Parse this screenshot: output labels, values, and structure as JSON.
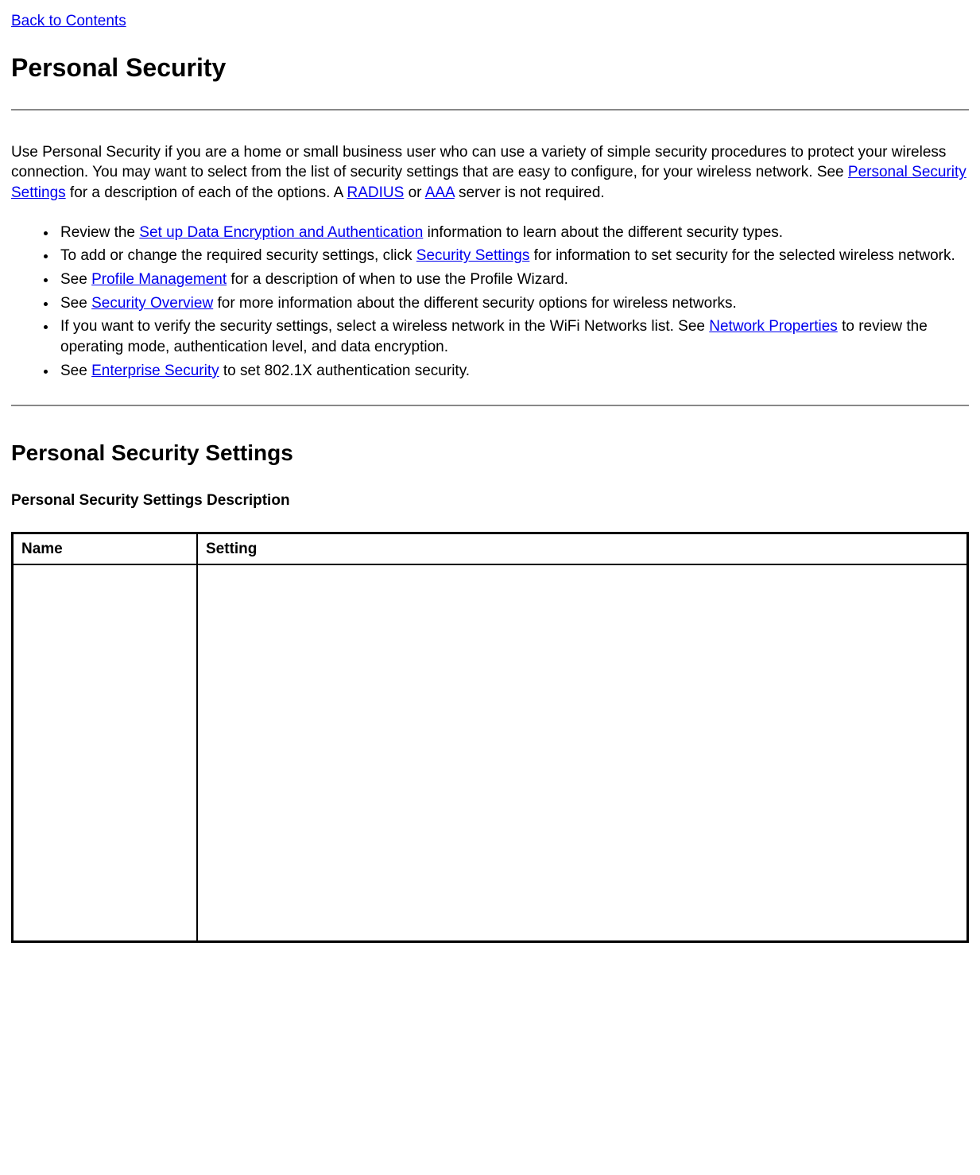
{
  "top_link": "Back to Contents",
  "h1": "Personal Security",
  "intro": {
    "t1": "Use Personal Security if you are a home or small business user who can use a variety of simple security procedures to protect your wireless connection. You may want to select from the list of security settings that are easy to configure, for your wireless network. See ",
    "link_personal_security_settings": "Personal Security Settings",
    "t2": " for a description of each of the options. A ",
    "link_radius": "RADIUS",
    "t3": " or ",
    "link_aaa": "AAA",
    "t4": " server is not required."
  },
  "bullets": {
    "b1_a": "Review the ",
    "b1_link": "Set up Data Encryption and Authentication",
    "b1_b": " information to learn about the different security types.",
    "b2_a": "To add or change the required security settings, click ",
    "b2_link": "Security Settings",
    "b2_b": " for information to set security for the selected wireless network.",
    "b3_a": "See ",
    "b3_link": "Profile Management",
    "b3_b": " for a description of when to use the Profile Wizard.",
    "b4_a": "See ",
    "b4_link": "Security Overview",
    "b4_b": " for more information about the different security options for wireless networks.",
    "b5_a": "If you want to verify the security settings, select a wireless network in the WiFi Networks list. See ",
    "b5_link": "Network Properties",
    "b5_b": " to review the operating mode, authentication level, and data encryption.",
    "b6_a": "See ",
    "b6_link": "Enterprise Security",
    "b6_b": " to set 802.1X authentication security."
  },
  "h2": "Personal Security Settings",
  "h3": "Personal Security Settings Description",
  "table": {
    "col1_header": "Name",
    "col2_header": "Setting",
    "row1_name": "",
    "row1_setting": ""
  }
}
